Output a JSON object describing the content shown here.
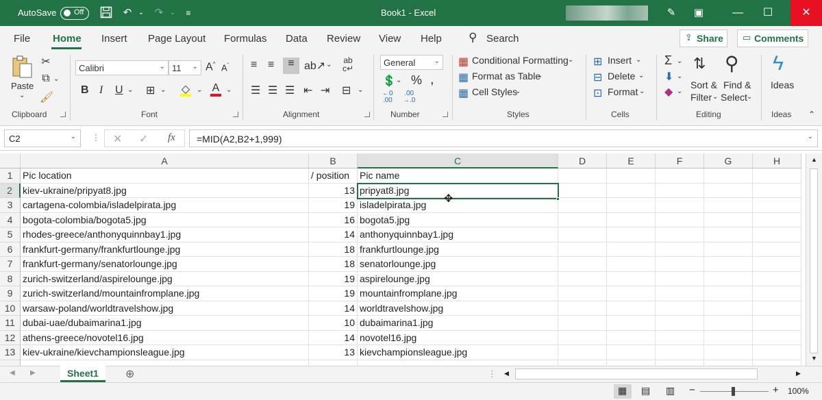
{
  "titlebar": {
    "autosave_label": "AutoSave",
    "autosave_state": "Off",
    "title": "Book1  -  Excel",
    "colors": {
      "brand": "#217346",
      "close": "#e81123"
    }
  },
  "menu": {
    "tabs": [
      "File",
      "Home",
      "Insert",
      "Page Layout",
      "Formulas",
      "Data",
      "Review",
      "View",
      "Help"
    ],
    "active_tab": "Home",
    "search_label": "Search",
    "share_label": "Share",
    "comments_label": "Comments"
  },
  "ribbon": {
    "clipboard": {
      "paste": "Paste",
      "label": "Clipboard"
    },
    "font": {
      "name": "Calibri",
      "size": "11",
      "label": "Font"
    },
    "alignment": {
      "label": "Alignment"
    },
    "number": {
      "format": "General",
      "label": "Number"
    },
    "styles": {
      "conditional": "Conditional Formatting",
      "format_table": "Format as Table",
      "cell_styles": "Cell Styles",
      "label": "Styles"
    },
    "cells": {
      "insert": "Insert",
      "delete": "Delete",
      "format": "Format",
      "label": "Cells"
    },
    "editing": {
      "sort1": "Sort &",
      "sort2": "Filter",
      "find1": "Find &",
      "find2": "Select",
      "label": "Editing"
    },
    "ideas": {
      "btn": "Ideas",
      "label": "Ideas"
    }
  },
  "formula_bar": {
    "name_box": "C2",
    "formula": "=MID(A2,B2+1,999)"
  },
  "grid": {
    "columns": [
      "A",
      "B",
      "C",
      "D",
      "E",
      "F",
      "G",
      "H"
    ],
    "selected_column": "C",
    "selected_row": "2",
    "rows": [
      {
        "n": "1",
        "a": "Pic location",
        "b": "/ position",
        "c": "Pic name"
      },
      {
        "n": "2",
        "a": "kiev-ukraine/pripyat8.jpg",
        "b": "13",
        "c": "pripyat8.jpg"
      },
      {
        "n": "3",
        "a": "cartagena-colombia/isladelpirata.jpg",
        "b": "19",
        "c": "isladelpirata.jpg"
      },
      {
        "n": "4",
        "a": "bogota-colombia/bogota5.jpg",
        "b": "16",
        "c": "bogota5.jpg"
      },
      {
        "n": "5",
        "a": "rhodes-greece/anthonyquinnbay1.jpg",
        "b": "14",
        "c": "anthonyquinnbay1.jpg"
      },
      {
        "n": "6",
        "a": "frankfurt-germany/frankfurtlounge.jpg",
        "b": "18",
        "c": "frankfurtlounge.jpg"
      },
      {
        "n": "7",
        "a": "frankfurt-germany/senatorlounge.jpg",
        "b": "18",
        "c": "senatorlounge.jpg"
      },
      {
        "n": "8",
        "a": "zurich-switzerland/aspirelounge.jpg",
        "b": "19",
        "c": "aspirelounge.jpg"
      },
      {
        "n": "9",
        "a": "zurich-switzerland/mountainfromplane.jpg",
        "b": "19",
        "c": "mountainfromplane.jpg"
      },
      {
        "n": "10",
        "a": "warsaw-poland/worldtravelshow.jpg",
        "b": "14",
        "c": "worldtravelshow.jpg"
      },
      {
        "n": "11",
        "a": "dubai-uae/dubaimarina1.jpg",
        "b": "10",
        "c": "dubaimarina1.jpg"
      },
      {
        "n": "12",
        "a": "athens-greece/novotel16.jpg",
        "b": "14",
        "c": "novotel16.jpg"
      },
      {
        "n": "13",
        "a": "kiev-ukraine/kievchampionsleague.jpg",
        "b": "13",
        "c": "kievchampionsleague.jpg"
      }
    ]
  },
  "sheets": {
    "active": "Sheet1"
  },
  "status": {
    "zoom": "100%"
  }
}
